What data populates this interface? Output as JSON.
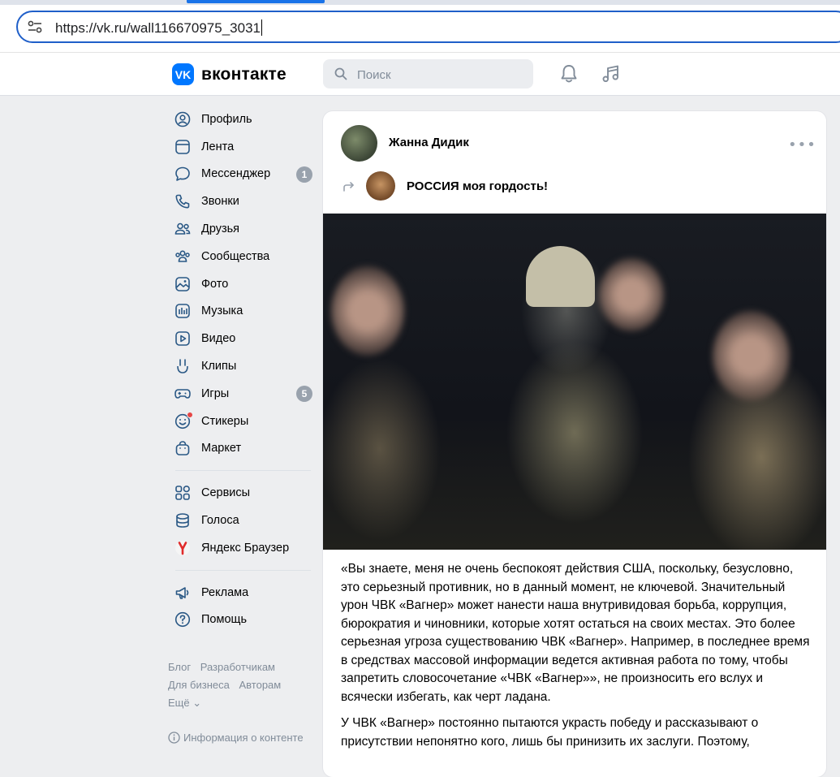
{
  "browser": {
    "url": "https://vk.ru/wall116670975_3031"
  },
  "header": {
    "logo_text": "вконтакте",
    "logo_mark": "VK",
    "search_placeholder": "Поиск",
    "icons": [
      "bell-icon",
      "music-note-icon"
    ]
  },
  "colors": {
    "accent": "#0077ff",
    "badge": "#99a2ad",
    "background": "#edeef0"
  },
  "nav": {
    "items": [
      {
        "label": "Профиль",
        "icon": "profile-icon"
      },
      {
        "label": "Лента",
        "icon": "feed-icon"
      },
      {
        "label": "Мессенджер",
        "icon": "messenger-icon",
        "badge": "1"
      },
      {
        "label": "Звонки",
        "icon": "phone-icon"
      },
      {
        "label": "Друзья",
        "icon": "friends-icon"
      },
      {
        "label": "Сообщества",
        "icon": "communities-icon"
      },
      {
        "label": "Фото",
        "icon": "photo-icon"
      },
      {
        "label": "Музыка",
        "icon": "music-icon"
      },
      {
        "label": "Видео",
        "icon": "video-icon"
      },
      {
        "label": "Клипы",
        "icon": "clips-icon"
      },
      {
        "label": "Игры",
        "icon": "games-icon",
        "badge": "5"
      },
      {
        "label": "Стикеры",
        "icon": "stickers-icon"
      },
      {
        "label": "Маркет",
        "icon": "market-icon"
      }
    ],
    "secondary": [
      {
        "label": "Сервисы",
        "icon": "services-icon"
      },
      {
        "label": "Голоса",
        "icon": "votes-icon"
      },
      {
        "label": "Яндекс Браузер",
        "icon": "yandex-icon"
      }
    ],
    "tertiary": [
      {
        "label": "Реклама",
        "icon": "ads-icon"
      },
      {
        "label": "Помощь",
        "icon": "help-icon"
      }
    ]
  },
  "footer": {
    "links": [
      "Блог",
      "Разработчикам",
      "Для бизнеса",
      "Авторам"
    ],
    "more": "Ещё ⌄",
    "content_info": "Информация о контенте"
  },
  "post": {
    "author": "Жанна Дидик",
    "more": "•••",
    "repost_from": "РОССИЯ моя гордость!",
    "paragraphs": [
      "«Вы знаете, меня не очень беспокоят действия США, поскольку, безусловно, это серьезный противник, но в данный момент, не ключевой. Значительный урон ЧВК «Вагнер» может нанести наша внутривидовая борьба, коррупция, бюрократия и чиновники, которые хотят остаться на своих местах. Это более серьезная угроза существованию ЧВК «Вагнер». Например, в последнее время в средствах массовой информации ведется активная работа по тому, чтобы запретить словосочетание «ЧВК «Вагнер»», не произносить его вслух и всячески избегать, как черт ладана.",
      "У ЧВК «Вагнер» постоянно пытаются украсть победу и рассказывают о присутствии непонятно кого, лишь бы принизить их заслуги. Поэтому,"
    ]
  }
}
